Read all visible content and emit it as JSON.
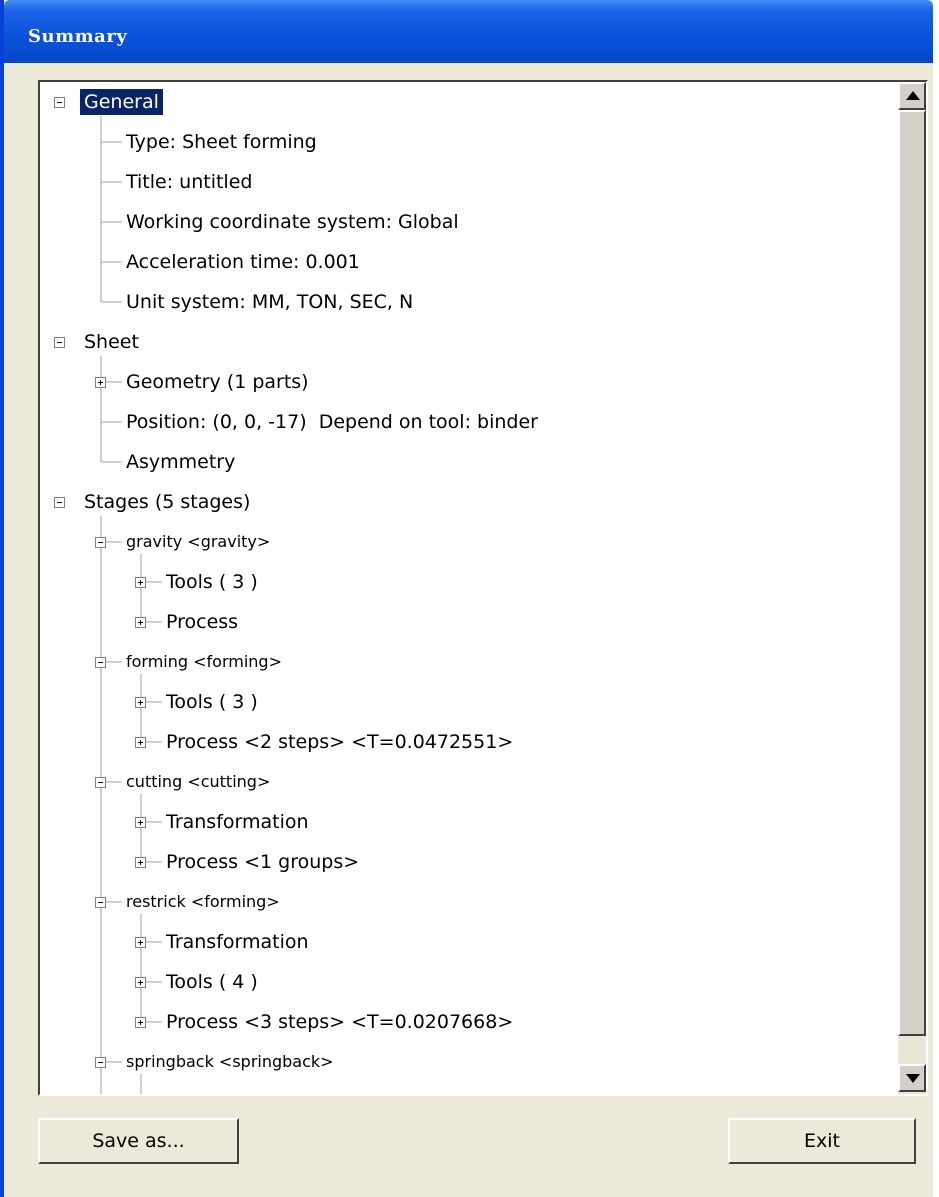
{
  "window": {
    "title": "Summary",
    "colors": {
      "titlebar": "#0a53dc",
      "selection": "#0a246a",
      "face": "#ece9d8"
    }
  },
  "tree": {
    "general": {
      "label": "General",
      "selected": true,
      "expanded": true,
      "children": [
        "Type: Sheet forming",
        "Title: untitled",
        "Working coordinate system: Global",
        "Acceleration time: 0.001",
        "Unit system: MM, TON, SEC, N"
      ]
    },
    "sheet": {
      "label": "Sheet",
      "expanded": true,
      "children": [
        "Geometry (1 parts)",
        "Position: (0, 0, -17)  Depend on tool: binder",
        "Asymmetry"
      ]
    },
    "stages": {
      "label": "Stages (5 stages)",
      "expanded": true,
      "items": [
        {
          "label": "gravity <gravity>",
          "children": [
            "Tools ( 3 )",
            "Process"
          ]
        },
        {
          "label": "forming <forming>",
          "children": [
            "Tools ( 3 )",
            "Process <2 steps> <T=0.0472551>"
          ]
        },
        {
          "label": "cutting <cutting>",
          "children": [
            "Transformation",
            "Process <1 groups>"
          ]
        },
        {
          "label": "restrick <forming>",
          "children": [
            "Transformation",
            "Tools ( 4 )",
            "Process <3 steps> <T=0.0207668>"
          ]
        },
        {
          "label": "springback <springback>",
          "children": []
        }
      ]
    }
  },
  "buttons": {
    "save_as": "Save as...",
    "exit": "Exit"
  }
}
